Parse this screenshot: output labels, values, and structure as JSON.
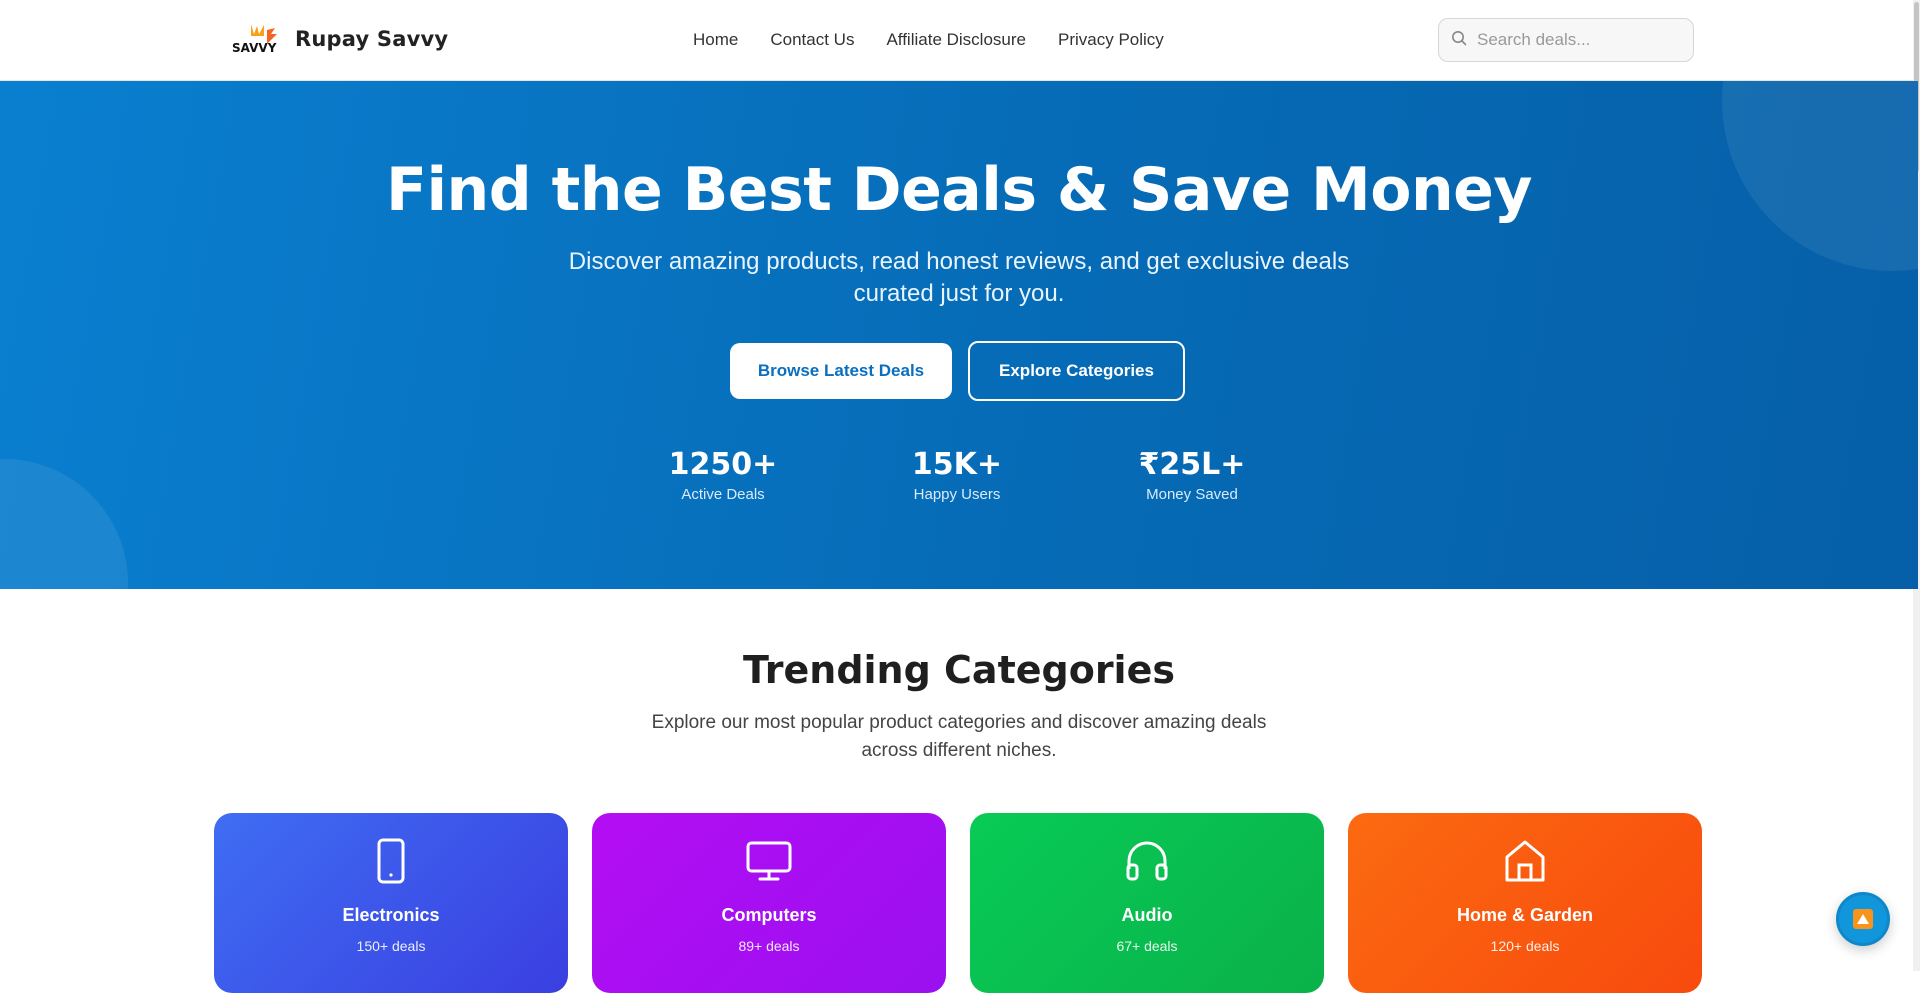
{
  "header": {
    "brand": "Rupay Savvy",
    "logo_text": "SAVVY",
    "nav": [
      "Home",
      "Contact Us",
      "Affiliate Disclosure",
      "Privacy Policy"
    ],
    "search_placeholder": "Search deals..."
  },
  "hero": {
    "title": "Find the Best Deals & Save Money",
    "subtitle": "Discover amazing products, read honest reviews, and get exclusive deals curated just for you.",
    "primary_button": "Browse Latest Deals",
    "secondary_button": "Explore Categories",
    "stats": [
      {
        "value": "1250+",
        "label": "Active Deals"
      },
      {
        "value": "15K+",
        "label": "Happy Users"
      },
      {
        "value": "₹25L+",
        "label": "Money Saved"
      }
    ]
  },
  "trending": {
    "title": "Trending Categories",
    "subtitle": "Explore our most popular product categories and discover amazing deals across different niches.",
    "categories": [
      {
        "name": "Electronics",
        "count": "150+ deals",
        "icon": "tablet-icon",
        "color_from": "#3f6df3",
        "color_to": "#3a3fe0"
      },
      {
        "name": "Computers",
        "count": "89+ deals",
        "icon": "monitor-icon",
        "color_from": "#b40df3",
        "color_to": "#9a10f0"
      },
      {
        "name": "Audio",
        "count": "67+ deals",
        "icon": "headphones-icon",
        "color_from": "#08cb55",
        "color_to": "#0ab14a"
      },
      {
        "name": "Home & Garden",
        "count": "120+ deals",
        "icon": "home-icon",
        "color_from": "#fb6a10",
        "color_to": "#f84a0e"
      }
    ]
  },
  "colors": {
    "hero_start": "#0a7fd0",
    "hero_end": "#065fa8",
    "accent": "#0a6fbf"
  }
}
